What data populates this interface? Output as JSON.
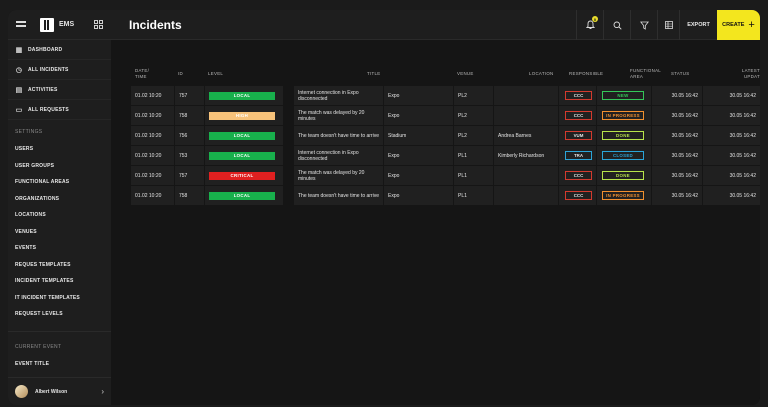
{
  "sidebar": {
    "app_name": "EMS",
    "nav": [
      {
        "label": "DASHBOARD",
        "icon": "dashboard-icon"
      },
      {
        "label": "ALL INCIDENTS",
        "icon": "clock-icon"
      },
      {
        "label": "ACTIVITIES",
        "icon": "calendar-icon"
      },
      {
        "label": "ALL REQUESTS",
        "icon": "chat-icon"
      }
    ],
    "settings_label": "SETTINGS",
    "settings": [
      "USERS",
      "USER GROUPS",
      "FUNCTIONAL AREAS",
      "ORGANIZATIONS",
      "LOCATIONS",
      "VENUES",
      "EVENTS",
      "REQUES TEMPLATES",
      "INCIDENT TEMPLATES",
      "IT INCIDENT TEMPLATES",
      "REQUEST LEVELS"
    ],
    "current_event_label": "CURRENT EVENT",
    "current_event": "EVENT TITLE",
    "user_name": "Albert Wilson"
  },
  "header": {
    "title": "Incidents",
    "notification_count": "0",
    "export_label": "EXPORT",
    "create_label": "CREATE",
    "create_icon": "+"
  },
  "table": {
    "columns": {
      "date_1": "DATE/",
      "date_2": "TIME",
      "id": "ID",
      "level": "LEVEL",
      "title": "TITLE",
      "venue": "VENUE",
      "location": "LOCATION",
      "responsible": "RESPONSIBLE",
      "farea_1": "FUNCTIONAL",
      "farea_2": "AREA",
      "status": "STATUS",
      "latest_1": "LATEST",
      "latest_2": "UPDAT"
    },
    "rows": [
      {
        "date": "01.02 10:20",
        "id": "757",
        "level": "LOCAL",
        "level_color": "#18b04c",
        "title": "Internet connection in Expo disconnected",
        "venue": "Expo",
        "farea": "PL2",
        "location": "",
        "responsible": "CCC",
        "resp_color": "#d23a2e",
        "status": "NEW",
        "status_color": "#34c759",
        "updated": "30.05 16:42",
        "latest": "30.05 16:42"
      },
      {
        "date": "01.02 10:20",
        "id": "758",
        "level": "HIGH",
        "level_color": "#f7c27a",
        "title": "The match was delayed by 20 minutes",
        "venue": "Expo",
        "farea": "PL2",
        "location": "",
        "responsible": "CCC",
        "resp_color": "#d23a2e",
        "status": "IN PROGRESS",
        "status_color": "#f0902f",
        "updated": "30.05 16:42",
        "latest": "30.05 16:42"
      },
      {
        "date": "01.02 10:20",
        "id": "756",
        "level": "LOCAL",
        "level_color": "#18b04c",
        "title": "The team doesn't have time to arrive",
        "venue": "Stadium",
        "farea": "PL2",
        "location": "Andrea Barnes",
        "responsible": "VUM",
        "resp_color": "#d23a2e",
        "status": "DONE",
        "status_color": "#b8e34a",
        "updated": "30.05 16:42",
        "latest": "30.05 16:42"
      },
      {
        "date": "01.02 10:20",
        "id": "753",
        "level": "LOCAL",
        "level_color": "#18b04c",
        "title": "Internet connection in Expo disconnected",
        "venue": "Expo",
        "farea": "PL1",
        "location": "Kimberly Richardson",
        "responsible": "TRA",
        "resp_color": "#2aa5d8",
        "status": "CLOSED",
        "status_color": "#2aa5d8",
        "updated": "30.05 16:42",
        "latest": "30.05 16:42"
      },
      {
        "date": "01.02 10:20",
        "id": "757",
        "level": "CRITICAL",
        "level_color": "#e02020",
        "title": "The match was delayed by 20 minutes",
        "venue": "Expo",
        "farea": "PL1",
        "location": "",
        "responsible": "CCC",
        "resp_color": "#d23a2e",
        "status": "DONE",
        "status_color": "#b8e34a",
        "updated": "30.05 16:42",
        "latest": "30.05 16:42"
      },
      {
        "date": "01.02 10:20",
        "id": "758",
        "level": "LOCAL",
        "level_color": "#18b04c",
        "title": "The team doesn't have time to arrive",
        "venue": "Expo",
        "farea": "PL1",
        "location": "",
        "responsible": "CCC",
        "resp_color": "#d23a2e",
        "status": "IN PROGRESS",
        "status_color": "#f0902f",
        "updated": "30.05 16:42",
        "latest": "30.05 16:42"
      }
    ]
  }
}
